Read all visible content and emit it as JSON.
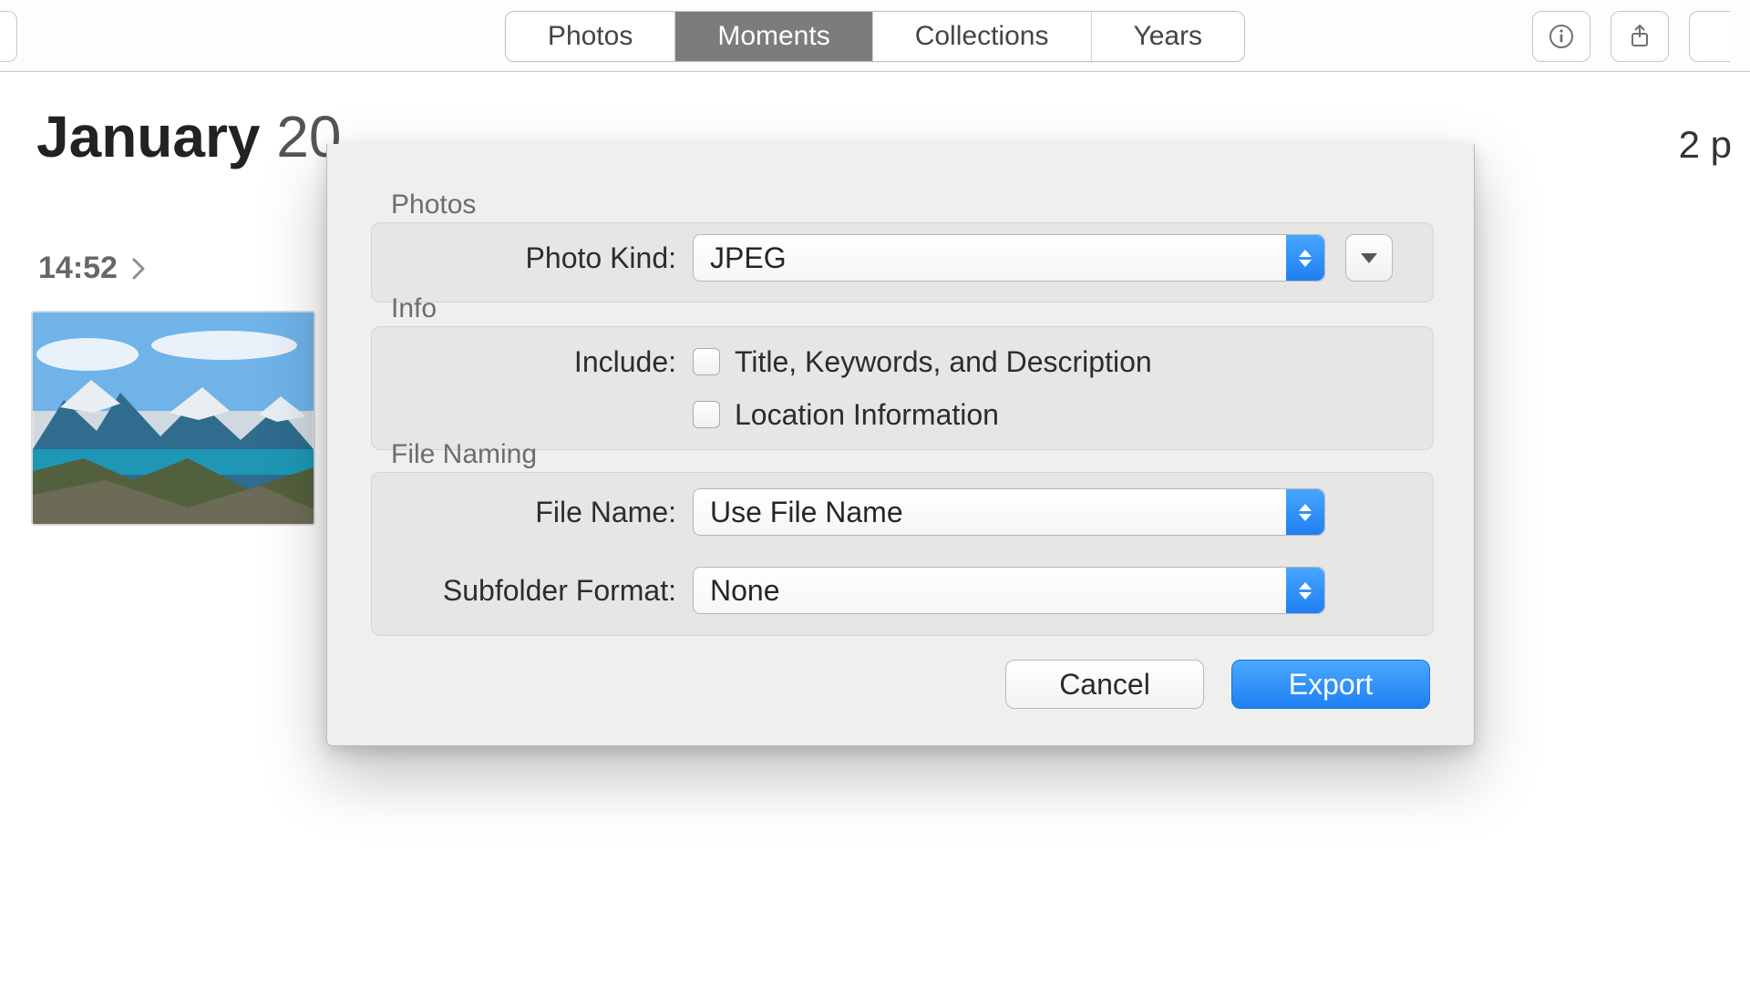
{
  "toolbar": {
    "tabs": [
      "Photos",
      "Moments",
      "Collections",
      "Years"
    ],
    "active_tab": "Moments"
  },
  "header": {
    "month": "January",
    "year_fragment": "20",
    "time": "14:52",
    "count_fragment": "2 p"
  },
  "dialog": {
    "sections": {
      "photos_label": "Photos",
      "info_label": "Info",
      "naming_label": "File Naming"
    },
    "photo_kind": {
      "label": "Photo Kind:",
      "value": "JPEG"
    },
    "include": {
      "label": "Include:",
      "opt_title": "Title, Keywords, and Description",
      "opt_location": "Location Information"
    },
    "file_name": {
      "label": "File Name:",
      "value": "Use File Name"
    },
    "subfolder": {
      "label": "Subfolder Format:",
      "value": "None"
    },
    "buttons": {
      "cancel": "Cancel",
      "export": "Export"
    }
  }
}
